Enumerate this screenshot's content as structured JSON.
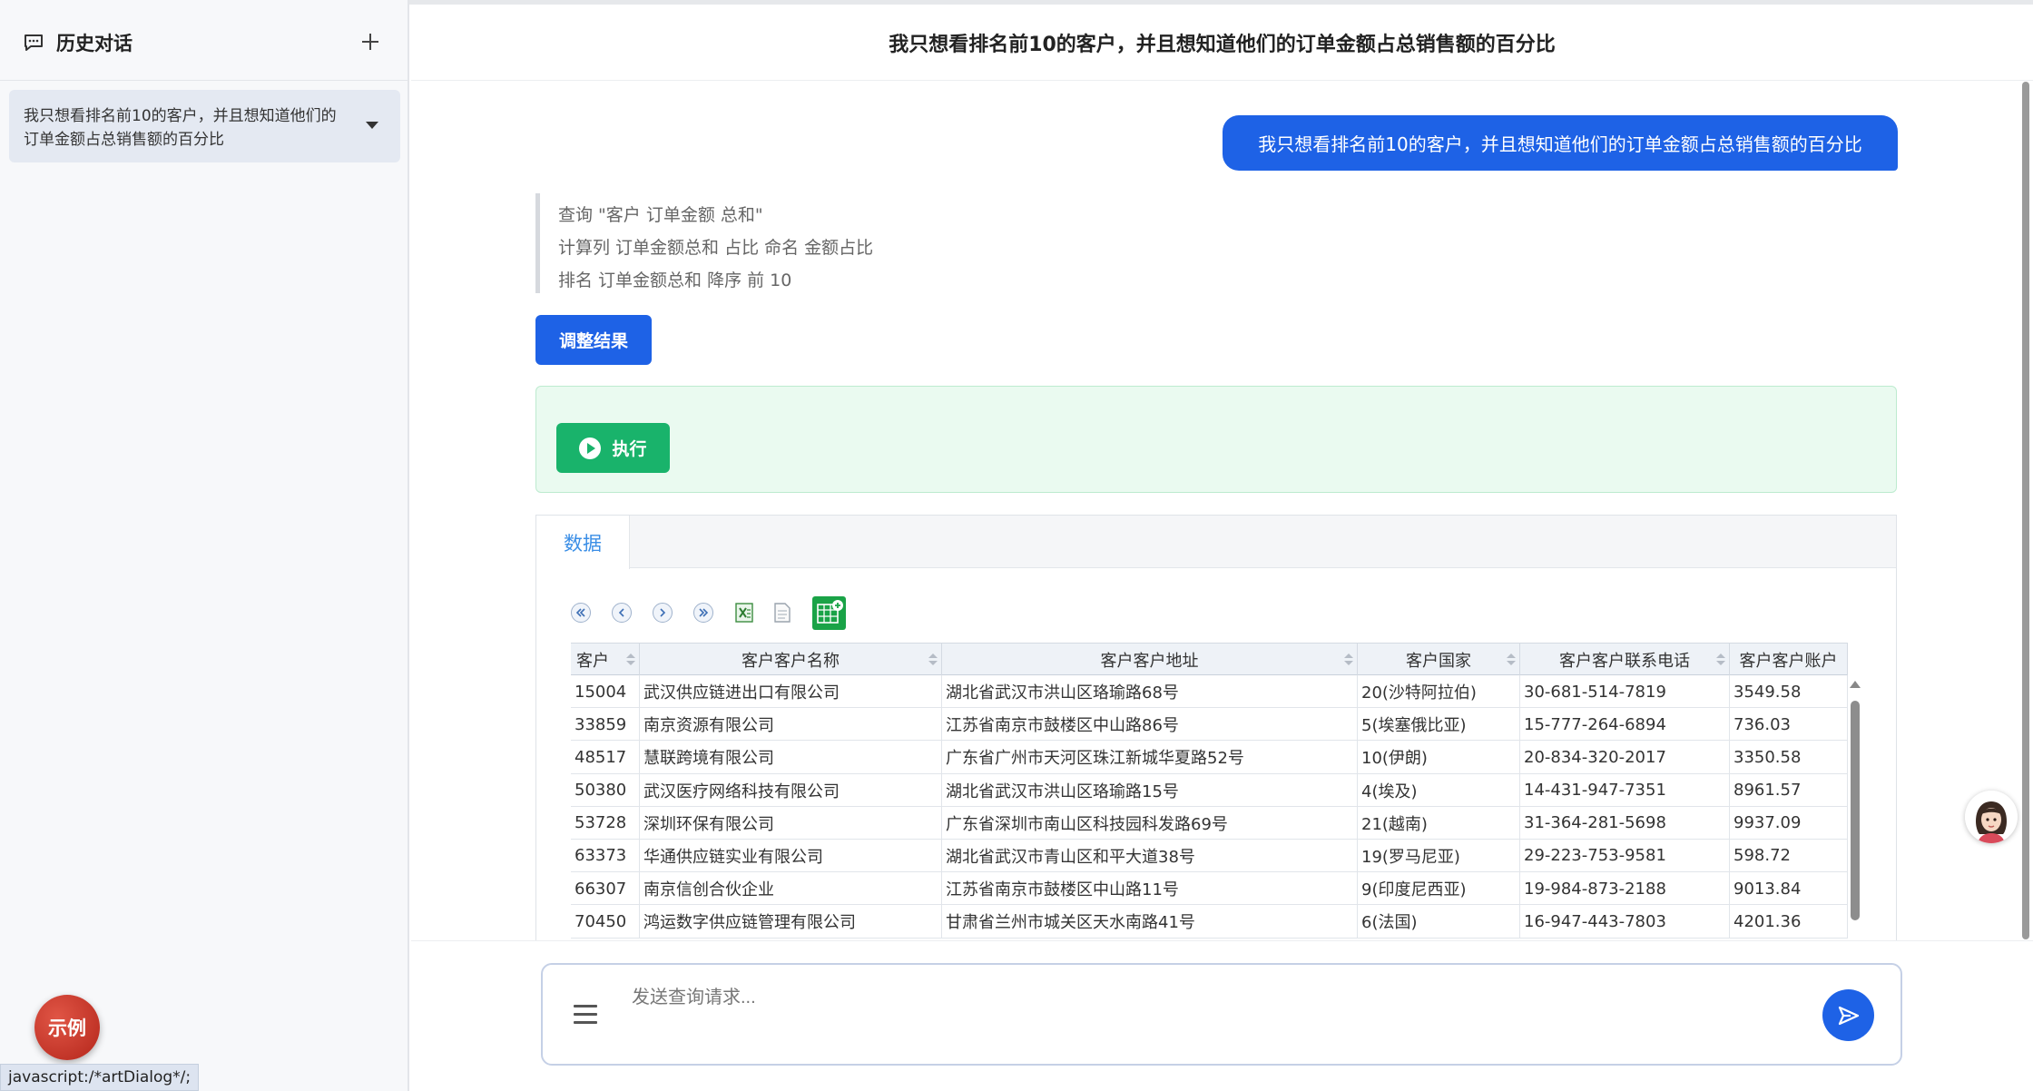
{
  "sidebar": {
    "title": "历史对话",
    "history": [
      {
        "label": "我只想看排名前10的客户，并且想知道他们的订单金额占总销售额的百分比"
      }
    ],
    "example_label": "示例"
  },
  "status_bar": {
    "url": "javascript:/*artDialog*/;"
  },
  "header": {
    "title": "我只想看排名前10的客户，并且想知道他们的订单金额占总销售额的百分比"
  },
  "conversation": {
    "user_message": "我只想看排名前10的客户，并且想知道他们的订单金额占总销售额的百分比",
    "steps": [
      "查询 \"客户 订单金额 总和\"",
      "计算列 订单金额总和 占比 命名 金额占比",
      "排名 订单金额总和 降序 前 10"
    ],
    "adjust_label": "调整结果",
    "execute_label": "执行"
  },
  "data_panel": {
    "tabs": [
      {
        "label": "数据"
      }
    ],
    "toolbar_icons": [
      "first-page-icon",
      "prev-page-icon",
      "next-page-icon",
      "last-page-icon",
      "excel-export-icon",
      "text-export-icon",
      "add-table-icon"
    ],
    "columns": [
      "客户",
      "客户客户名称",
      "客户客户地址",
      "客户国家",
      "客户客户联系电话",
      "客户客户账户"
    ],
    "rows": [
      [
        "15004",
        "武汉供应链进出口有限公司",
        "湖北省武汉市洪山区珞瑜路68号",
        "20(沙特阿拉伯)",
        "30-681-514-7819",
        "3549.58"
      ],
      [
        "33859",
        "南京资源有限公司",
        "江苏省南京市鼓楼区中山路86号",
        "5(埃塞俄比亚)",
        "15-777-264-6894",
        "736.03"
      ],
      [
        "48517",
        "慧联跨境有限公司",
        "广东省广州市天河区珠江新城华夏路52号",
        "10(伊朗)",
        "20-834-320-2017",
        "3350.58"
      ],
      [
        "50380",
        "武汉医疗网络科技有限公司",
        "湖北省武汉市洪山区珞瑜路15号",
        "4(埃及)",
        "14-431-947-7351",
        "8961.57"
      ],
      [
        "53728",
        "深圳环保有限公司",
        "广东省深圳市南山区科技园科发路69号",
        "21(越南)",
        "31-364-281-5698",
        "9937.09"
      ],
      [
        "63373",
        "华通供应链实业有限公司",
        "湖北省武汉市青山区和平大道38号",
        "19(罗马尼亚)",
        "29-223-753-9581",
        "598.72"
      ],
      [
        "66307",
        "南京信创合伙企业",
        "江苏省南京市鼓楼区中山路11号",
        "9(印度尼西亚)",
        "19-984-873-2188",
        "9013.84"
      ],
      [
        "70450",
        "鸿运数字供应链管理有限公司",
        "甘肃省兰州市城关区天水南路41号",
        "6(法国)",
        "16-947-443-7803",
        "4201.36"
      ]
    ]
  },
  "input": {
    "placeholder": "发送查询请求..."
  },
  "colors": {
    "primary": "#1e62e6",
    "success": "#19b36b",
    "danger": "#c8372b",
    "tab_active": "#3a8ee6"
  }
}
